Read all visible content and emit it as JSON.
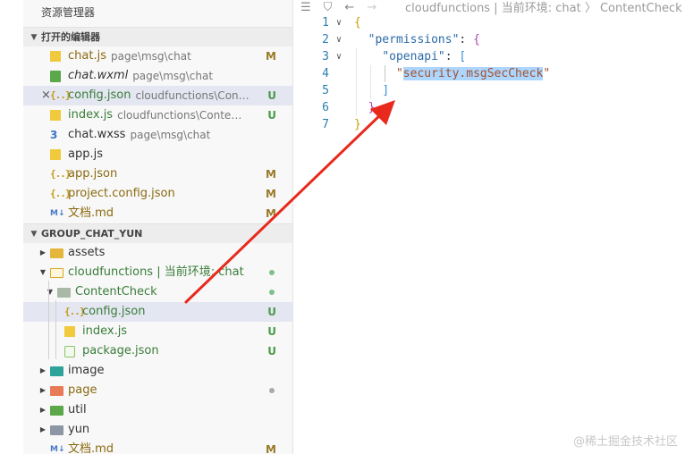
{
  "explorer": {
    "title": "资源管理器",
    "open_editors": {
      "header": "打开的编辑器",
      "items": [
        {
          "name": "chat.js",
          "path": "page\\msg\\chat",
          "badge": "M"
        },
        {
          "name": "chat.wxml",
          "path": "page\\msg\\chat",
          "badge": ""
        },
        {
          "name": "config.json",
          "path": "cloudfunctions\\Conte...",
          "badge": "U"
        },
        {
          "name": "index.js",
          "path": "cloudfunctions\\ContentCh...",
          "badge": "U"
        },
        {
          "name": "chat.wxss",
          "path": "page\\msg\\chat",
          "badge": ""
        },
        {
          "name": "app.js",
          "path": "",
          "badge": ""
        },
        {
          "name": "app.json",
          "path": "",
          "badge": "M"
        },
        {
          "name": "project.config.json",
          "path": "",
          "badge": "M"
        },
        {
          "name": "文档.md",
          "path": "",
          "badge": "M"
        }
      ]
    },
    "workspace": {
      "header": "GROUP_CHAT_YUN",
      "items": [
        {
          "name": "assets",
          "badge": ""
        },
        {
          "name": "cloudfunctions | 当前环境: chat",
          "badge": ""
        },
        {
          "name": "ContentCheck",
          "badge": ""
        },
        {
          "name": "config.json",
          "badge": "U"
        },
        {
          "name": "index.js",
          "badge": "U"
        },
        {
          "name": "package.json",
          "badge": "U"
        },
        {
          "name": "image",
          "badge": ""
        },
        {
          "name": "page",
          "badge": ""
        },
        {
          "name": "util",
          "badge": ""
        },
        {
          "name": "yun",
          "badge": ""
        },
        {
          "name": "文档.md",
          "badge": "M"
        }
      ]
    },
    "icons": {
      "close": "×",
      "json": "{..}",
      "wxss": "3",
      "md": "M↓",
      "chevron_down": "▼",
      "chevron_right": "▶"
    }
  },
  "editor": {
    "breadcrumb": "cloudfunctions | 当前环境: chat  〉 ContentCheck 〉 {",
    "line_numbers": [
      "1",
      "2",
      "3",
      "4",
      "5",
      "6",
      "7"
    ],
    "code": {
      "l1_open": "{",
      "l2_key": "\"permissions\"",
      "l2_punct": ": ",
      "l2_open": "{",
      "l3_key": "\"openapi\"",
      "l3_punct": ": ",
      "l3_open": "[",
      "l4_quote": "\"",
      "l4_val": "security.msgSecCheck",
      "l4_quote_end": "\"",
      "l5_close": "]",
      "l6_close": "}",
      "l7_close": "}"
    },
    "fold_icon": "∨"
  },
  "watermark": "@稀土掘金技术社区",
  "colors": {
    "annotation_arrow": "#e8291c",
    "selection": "#e4e6f1",
    "modified": "#9a7a28",
    "untracked": "#4a9b4a"
  }
}
